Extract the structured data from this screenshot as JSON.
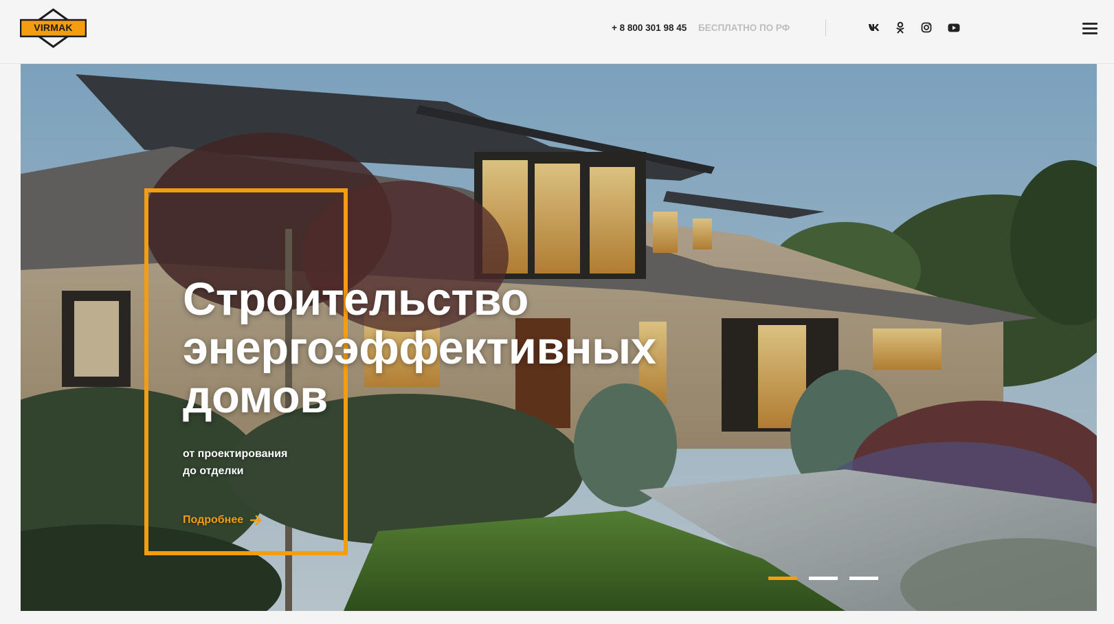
{
  "header": {
    "logo_text": "VIRMAK",
    "phone": "+ 8 800 301 98 45",
    "phone_note": "БЕСПЛАТНО ПО РФ",
    "social": [
      {
        "icon": "vk-icon"
      },
      {
        "icon": "odnoklassniki-icon"
      },
      {
        "icon": "instagram-icon"
      },
      {
        "icon": "youtube-icon"
      }
    ],
    "menu_icon": "hamburger-icon"
  },
  "hero": {
    "title_line1": "Строительство",
    "title_line2": "энергоэффективных",
    "title_line3": "домов",
    "subtitle_line1": "от проектирования",
    "subtitle_line2": "до отделки",
    "more_label": "Подробнее",
    "slides": [
      {
        "active": true
      },
      {
        "active": false
      },
      {
        "active": false
      }
    ]
  },
  "colors": {
    "accent": "#f59d11",
    "header_bg": "#f5f5f5",
    "text_dark": "#222222",
    "text_muted": "#bdbdbd"
  }
}
